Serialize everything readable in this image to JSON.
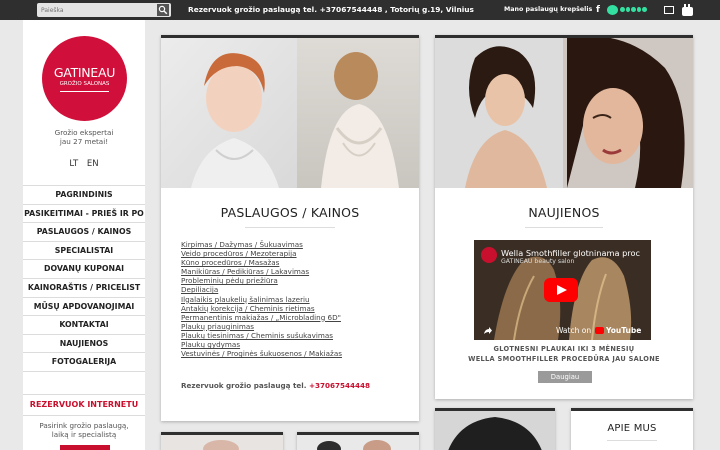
{
  "topbar": {
    "search_placeholder": "Paieška",
    "booking_text": "Rezervuok grožio paslaugą tel. +37067544448 , Totorių g.19, Vilnius",
    "cart_label": "Mano paslaugų krepšelis",
    "icons": [
      "search-icon",
      "facebook-icon",
      "tripadvisor-icon",
      "mail-icon",
      "youtube-icon"
    ],
    "colors": {
      "bar": "#2f2f2f",
      "tripadvisor": "#34e0a1"
    }
  },
  "sidebar": {
    "logo": {
      "brand": "GATINEAU",
      "subtitle": "GROŽIO SALONAS",
      "color": "#d0103a"
    },
    "tagline": [
      "Grožio ekspertai",
      "jau 27 metai!"
    ],
    "languages": [
      "LT",
      "EN"
    ],
    "nav": [
      "PAGRINDINIS",
      "PASIKEITIMAI - PRIEŠ IR PO",
      "PASLAUGOS / KAINOS",
      "SPECIALISTAI",
      "DOVANŲ KUPONAI",
      "KAINORAŠTIS / PRICELIST",
      "MŪSŲ APDOVANOJIMAI",
      "KONTAKTAI",
      "NAUJIENOS",
      "FOTOGALERIJA"
    ],
    "booking": {
      "heading": "REZERVUOK INTERNETU",
      "text": [
        "Pasirink grožio paslaugą,",
        "laiką ir specialistą"
      ]
    }
  },
  "services_card": {
    "title": "PASLAUGOS / KAINOS",
    "links": [
      "Kirpimas / Dažymas / Šukuavimas",
      "Veido procedūros / Mezoterapija",
      "Kūno procedūros / Masažas",
      "Manikiūras / Pedikiūras / Lakavimas",
      "Probleminių pėdų priežiūra",
      "Depiliacija",
      "Ilgalaikis plaukelių šalinimas lazeriu",
      "Antakių korekcija / Cheminis rietimas",
      "Permanentinis makiažas / „Microblading 6D\"",
      "Plaukų priauginimas",
      "Plaukų tiesinimas / Cheminis sušukavimas",
      "Plaukų gydymas",
      "Vestuvinės / Proginės šukuosenos / Makiažas"
    ],
    "call_label": "Rezervuok grožio paslaugą tel.",
    "call_phone": "+37067544448"
  },
  "news_card": {
    "title": "NAUJIENOS",
    "video": {
      "title": "Wella Smothfiller glotninama proc",
      "channel": "GATINEAU beauty salon",
      "watch_on": "Watch on",
      "platform": "YouTube"
    },
    "text": [
      "GLOTNESNI PLAUKAI IKI 3 MĖNESIŲ",
      "WELLA SMOOTHFILLER PROCEDŪRA JAU SALONE"
    ],
    "more_button": "Daugiau"
  },
  "about_card": {
    "title": "APIE MUS"
  },
  "accent": "#c8102e"
}
